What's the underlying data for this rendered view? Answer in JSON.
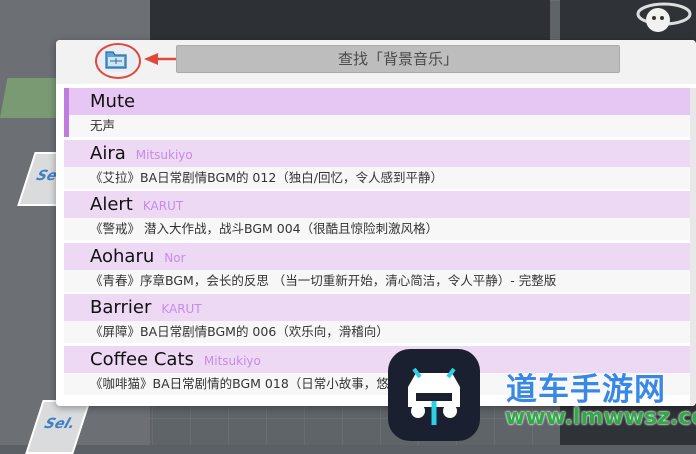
{
  "background": {
    "chip_labels": [
      "Se",
      "Sel."
    ]
  },
  "dialog": {
    "search_placeholder": "查找「背景音乐」",
    "folder_icon": "folder-icon",
    "tracks": [
      {
        "title": "Mute",
        "artist": "",
        "description": "无声",
        "selected": true
      },
      {
        "title": "Aira",
        "artist": "Mitsukiyo",
        "description": "《艾拉》BA日常剧情BGM的 012（独白/回忆，令人感到平静）",
        "selected": false
      },
      {
        "title": "Alert",
        "artist": "KARUT",
        "description": "《警戒》 潜入大作战，战斗BGM 004（很酷且惊险刺激风格）",
        "selected": false
      },
      {
        "title": "Aoharu",
        "artist": "Nor",
        "description": "《青春》序章BGM，会长的反思 （当一切重新开始，清心简洁，令人平静）- 完整版",
        "selected": false
      },
      {
        "title": "Barrier",
        "artist": "KARUT",
        "description": "《屏障》BA日常剧情BGM的 006（欢乐向，滑稽向）",
        "selected": false
      },
      {
        "title": "Coffee Cats",
        "artist": "Mitsukiyo",
        "description": "《咖啡猫》BA日常剧情的BGM 018（日常小故事，悠闲发生的",
        "selected": false
      }
    ]
  },
  "watermark": {
    "site_name": "道车手游网",
    "url": "www.lmwwsz.com"
  },
  "colors": {
    "accent_annotation": "#e0483c",
    "row_title_bg": "#eed9f5",
    "selected_bar": "#c07de0",
    "artist": "#c78be6"
  }
}
